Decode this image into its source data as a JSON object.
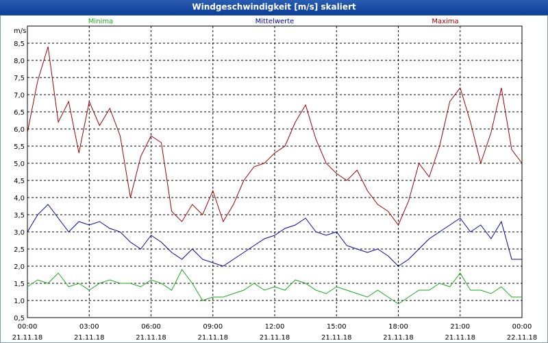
{
  "window": {
    "title": "Windgeschwindigkeit [m/s] skaliert"
  },
  "colors": {
    "minima": "#1aa81a",
    "mittelwerte": "#0000b0",
    "maxima": "#a00000",
    "grid": "#000000",
    "titlebar": "#1f53a8"
  },
  "chart_data": {
    "type": "line",
    "title": "Windgeschwindigkeit [m/s] skaliert",
    "ylabel": "m/s",
    "ylim": [
      0.5,
      9.0
    ],
    "y_ticks": [
      "0,5",
      "1,0",
      "1,5",
      "2,0",
      "2,5",
      "3,0",
      "3,5",
      "4,0",
      "4,5",
      "5,0",
      "5,5",
      "6,0",
      "6,5",
      "7,0",
      "7,5",
      "8,0",
      "8,5"
    ],
    "x_ticks": [
      {
        "time": "00:00",
        "date": "21.11.18"
      },
      {
        "time": "03:00",
        "date": "21.11.18"
      },
      {
        "time": "06:00",
        "date": "21.11.18"
      },
      {
        "time": "09:00",
        "date": "21.11.18"
      },
      {
        "time": "12:00",
        "date": "21.11.18"
      },
      {
        "time": "15:00",
        "date": "21.11.18"
      },
      {
        "time": "18:00",
        "date": "21.11.18"
      },
      {
        "time": "21:00",
        "date": "21.11.18"
      },
      {
        "time": "00:00",
        "date": "22.11.18"
      }
    ],
    "x_hours": [
      0,
      0.5,
      1,
      1.5,
      2,
      2.5,
      3,
      3.5,
      4,
      4.5,
      5,
      5.5,
      6,
      6.5,
      7,
      7.5,
      8,
      8.5,
      9,
      9.5,
      10,
      10.5,
      11,
      11.5,
      12,
      12.5,
      13,
      13.5,
      14,
      14.5,
      15,
      15.5,
      16,
      16.5,
      17,
      17.5,
      18,
      18.5,
      19,
      19.5,
      20,
      20.5,
      21,
      21.5,
      22,
      22.5,
      23,
      23.5,
      24
    ],
    "series": [
      {
        "name": "Minima",
        "color": "#1aa81a",
        "values": [
          1.4,
          1.6,
          1.5,
          1.8,
          1.4,
          1.5,
          1.3,
          1.5,
          1.6,
          1.5,
          1.5,
          1.4,
          1.6,
          1.5,
          1.3,
          1.9,
          1.5,
          1.0,
          1.1,
          1.1,
          1.2,
          1.3,
          1.5,
          1.3,
          1.4,
          1.3,
          1.6,
          1.5,
          1.3,
          1.2,
          1.4,
          1.3,
          1.2,
          1.1,
          1.3,
          1.1,
          0.9,
          1.1,
          1.3,
          1.3,
          1.5,
          1.4,
          1.8,
          1.3,
          1.3,
          1.2,
          1.4,
          1.1,
          1.1
        ]
      },
      {
        "name": "Mittelwerte",
        "color": "#0000b0",
        "values": [
          3.0,
          3.5,
          3.8,
          3.4,
          3.0,
          3.3,
          3.2,
          3.3,
          3.1,
          3.0,
          2.7,
          2.5,
          2.9,
          2.7,
          2.4,
          2.2,
          2.5,
          2.2,
          2.1,
          2.0,
          2.2,
          2.4,
          2.6,
          2.8,
          2.9,
          3.1,
          3.2,
          3.4,
          3.0,
          2.9,
          3.0,
          2.6,
          2.5,
          2.4,
          2.5,
          2.3,
          2.0,
          2.2,
          2.5,
          2.8,
          3.0,
          3.2,
          3.4,
          3.0,
          3.2,
          2.8,
          3.3,
          2.2,
          2.2
        ]
      },
      {
        "name": "Maxima",
        "color": "#a00000",
        "values": [
          5.9,
          7.4,
          8.4,
          6.2,
          6.8,
          5.3,
          6.8,
          6.1,
          6.6,
          5.8,
          4.0,
          5.2,
          5.8,
          5.6,
          3.6,
          3.3,
          3.8,
          3.5,
          4.2,
          3.3,
          3.8,
          4.5,
          4.9,
          5.0,
          5.3,
          5.5,
          6.2,
          6.7,
          5.7,
          5.0,
          4.7,
          4.5,
          4.8,
          4.2,
          3.8,
          3.6,
          3.2,
          3.9,
          5.0,
          4.6,
          5.5,
          6.8,
          7.2,
          6.2,
          5.0,
          5.9,
          7.2,
          5.4,
          5.0
        ]
      }
    ]
  }
}
